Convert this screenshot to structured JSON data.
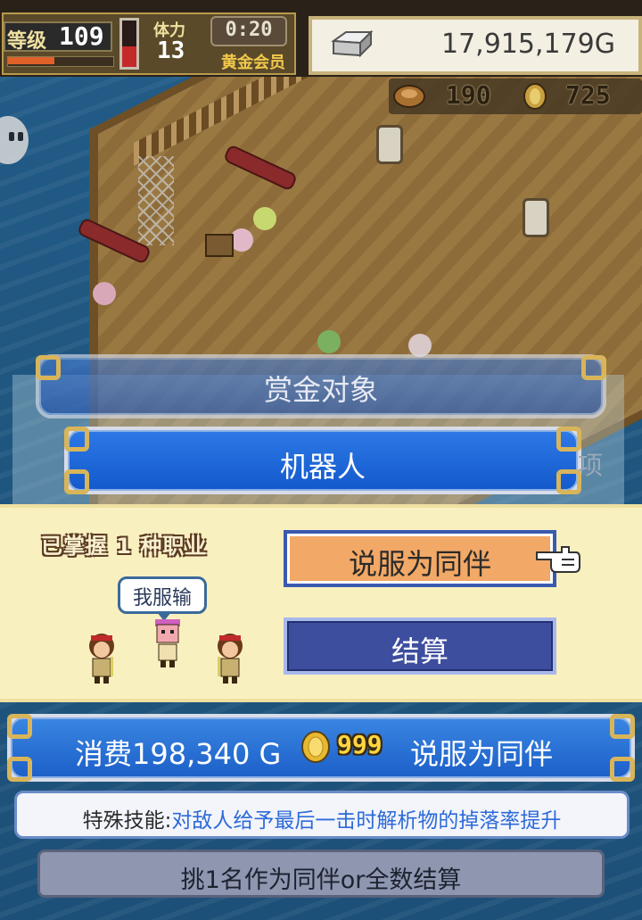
{
  "hud": {
    "level_label": "等级",
    "level": "109",
    "level_progress": 0.45,
    "hp_fill": 0.45,
    "fame_label": "体力",
    "fame_value": "13",
    "timer": "0:20",
    "member_status": "黄金会员",
    "gold": "17,915,179G",
    "resource_1": "190",
    "resource_2": "725",
    "icons": [
      "gold-bar-icon",
      "food-icon",
      "medal-coin-icon",
      "chat-icon"
    ]
  },
  "dialog": {
    "bounty_title": "赏金对象",
    "target_name": "机器人",
    "hidden_char": "项",
    "mastered_label": "已掌握 1 种职业",
    "speech": "我服输",
    "recruit_button": "说服为同伴",
    "settle_button": "结算",
    "cost_text": "消费198,340 G",
    "medal_cost": "999",
    "cost_suffix": "说服为同伴",
    "skill_label": "特殊技能:",
    "skill_desc": "对敌人给予最后一击时解析物的掉落率提升",
    "hint": "挑1名作为同伴or全数结算"
  },
  "colors": {
    "panel_bg": "#f9f0c0",
    "recruit_btn": "#f2a866",
    "settle_btn": "#3d4e9e",
    "primary_blue": "#1c5fc8",
    "skill_desc": "#2d6ad8",
    "gold_accent": "#d9b55a"
  }
}
